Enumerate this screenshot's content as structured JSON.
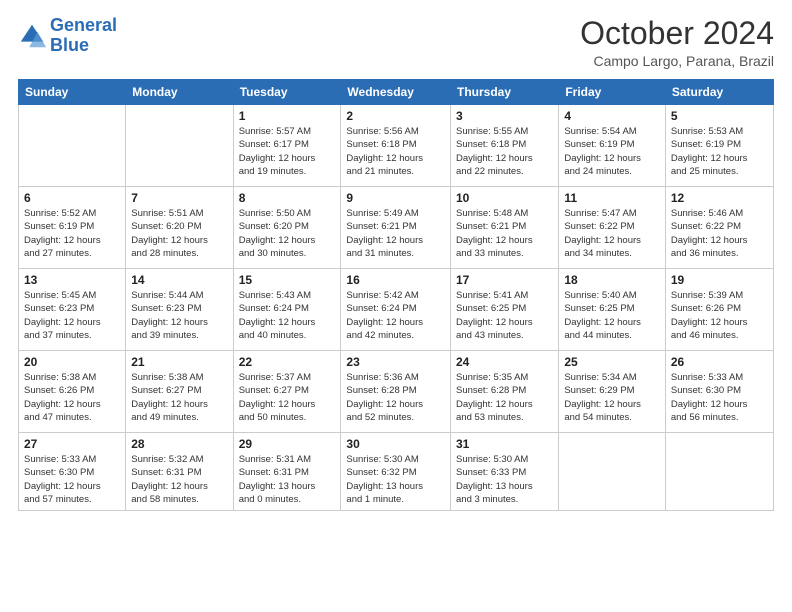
{
  "logo": {
    "line1": "General",
    "line2": "Blue"
  },
  "header": {
    "month": "October 2024",
    "location": "Campo Largo, Parana, Brazil"
  },
  "weekdays": [
    "Sunday",
    "Monday",
    "Tuesday",
    "Wednesday",
    "Thursday",
    "Friday",
    "Saturday"
  ],
  "weeks": [
    [
      {
        "day": "",
        "info": ""
      },
      {
        "day": "",
        "info": ""
      },
      {
        "day": "1",
        "info": "Sunrise: 5:57 AM\nSunset: 6:17 PM\nDaylight: 12 hours\nand 19 minutes."
      },
      {
        "day": "2",
        "info": "Sunrise: 5:56 AM\nSunset: 6:18 PM\nDaylight: 12 hours\nand 21 minutes."
      },
      {
        "day": "3",
        "info": "Sunrise: 5:55 AM\nSunset: 6:18 PM\nDaylight: 12 hours\nand 22 minutes."
      },
      {
        "day": "4",
        "info": "Sunrise: 5:54 AM\nSunset: 6:19 PM\nDaylight: 12 hours\nand 24 minutes."
      },
      {
        "day": "5",
        "info": "Sunrise: 5:53 AM\nSunset: 6:19 PM\nDaylight: 12 hours\nand 25 minutes."
      }
    ],
    [
      {
        "day": "6",
        "info": "Sunrise: 5:52 AM\nSunset: 6:19 PM\nDaylight: 12 hours\nand 27 minutes."
      },
      {
        "day": "7",
        "info": "Sunrise: 5:51 AM\nSunset: 6:20 PM\nDaylight: 12 hours\nand 28 minutes."
      },
      {
        "day": "8",
        "info": "Sunrise: 5:50 AM\nSunset: 6:20 PM\nDaylight: 12 hours\nand 30 minutes."
      },
      {
        "day": "9",
        "info": "Sunrise: 5:49 AM\nSunset: 6:21 PM\nDaylight: 12 hours\nand 31 minutes."
      },
      {
        "day": "10",
        "info": "Sunrise: 5:48 AM\nSunset: 6:21 PM\nDaylight: 12 hours\nand 33 minutes."
      },
      {
        "day": "11",
        "info": "Sunrise: 5:47 AM\nSunset: 6:22 PM\nDaylight: 12 hours\nand 34 minutes."
      },
      {
        "day": "12",
        "info": "Sunrise: 5:46 AM\nSunset: 6:22 PM\nDaylight: 12 hours\nand 36 minutes."
      }
    ],
    [
      {
        "day": "13",
        "info": "Sunrise: 5:45 AM\nSunset: 6:23 PM\nDaylight: 12 hours\nand 37 minutes."
      },
      {
        "day": "14",
        "info": "Sunrise: 5:44 AM\nSunset: 6:23 PM\nDaylight: 12 hours\nand 39 minutes."
      },
      {
        "day": "15",
        "info": "Sunrise: 5:43 AM\nSunset: 6:24 PM\nDaylight: 12 hours\nand 40 minutes."
      },
      {
        "day": "16",
        "info": "Sunrise: 5:42 AM\nSunset: 6:24 PM\nDaylight: 12 hours\nand 42 minutes."
      },
      {
        "day": "17",
        "info": "Sunrise: 5:41 AM\nSunset: 6:25 PM\nDaylight: 12 hours\nand 43 minutes."
      },
      {
        "day": "18",
        "info": "Sunrise: 5:40 AM\nSunset: 6:25 PM\nDaylight: 12 hours\nand 44 minutes."
      },
      {
        "day": "19",
        "info": "Sunrise: 5:39 AM\nSunset: 6:26 PM\nDaylight: 12 hours\nand 46 minutes."
      }
    ],
    [
      {
        "day": "20",
        "info": "Sunrise: 5:38 AM\nSunset: 6:26 PM\nDaylight: 12 hours\nand 47 minutes."
      },
      {
        "day": "21",
        "info": "Sunrise: 5:38 AM\nSunset: 6:27 PM\nDaylight: 12 hours\nand 49 minutes."
      },
      {
        "day": "22",
        "info": "Sunrise: 5:37 AM\nSunset: 6:27 PM\nDaylight: 12 hours\nand 50 minutes."
      },
      {
        "day": "23",
        "info": "Sunrise: 5:36 AM\nSunset: 6:28 PM\nDaylight: 12 hours\nand 52 minutes."
      },
      {
        "day": "24",
        "info": "Sunrise: 5:35 AM\nSunset: 6:28 PM\nDaylight: 12 hours\nand 53 minutes."
      },
      {
        "day": "25",
        "info": "Sunrise: 5:34 AM\nSunset: 6:29 PM\nDaylight: 12 hours\nand 54 minutes."
      },
      {
        "day": "26",
        "info": "Sunrise: 5:33 AM\nSunset: 6:30 PM\nDaylight: 12 hours\nand 56 minutes."
      }
    ],
    [
      {
        "day": "27",
        "info": "Sunrise: 5:33 AM\nSunset: 6:30 PM\nDaylight: 12 hours\nand 57 minutes."
      },
      {
        "day": "28",
        "info": "Sunrise: 5:32 AM\nSunset: 6:31 PM\nDaylight: 12 hours\nand 58 minutes."
      },
      {
        "day": "29",
        "info": "Sunrise: 5:31 AM\nSunset: 6:31 PM\nDaylight: 13 hours\nand 0 minutes."
      },
      {
        "day": "30",
        "info": "Sunrise: 5:30 AM\nSunset: 6:32 PM\nDaylight: 13 hours\nand 1 minute."
      },
      {
        "day": "31",
        "info": "Sunrise: 5:30 AM\nSunset: 6:33 PM\nDaylight: 13 hours\nand 3 minutes."
      },
      {
        "day": "",
        "info": ""
      },
      {
        "day": "",
        "info": ""
      }
    ]
  ]
}
